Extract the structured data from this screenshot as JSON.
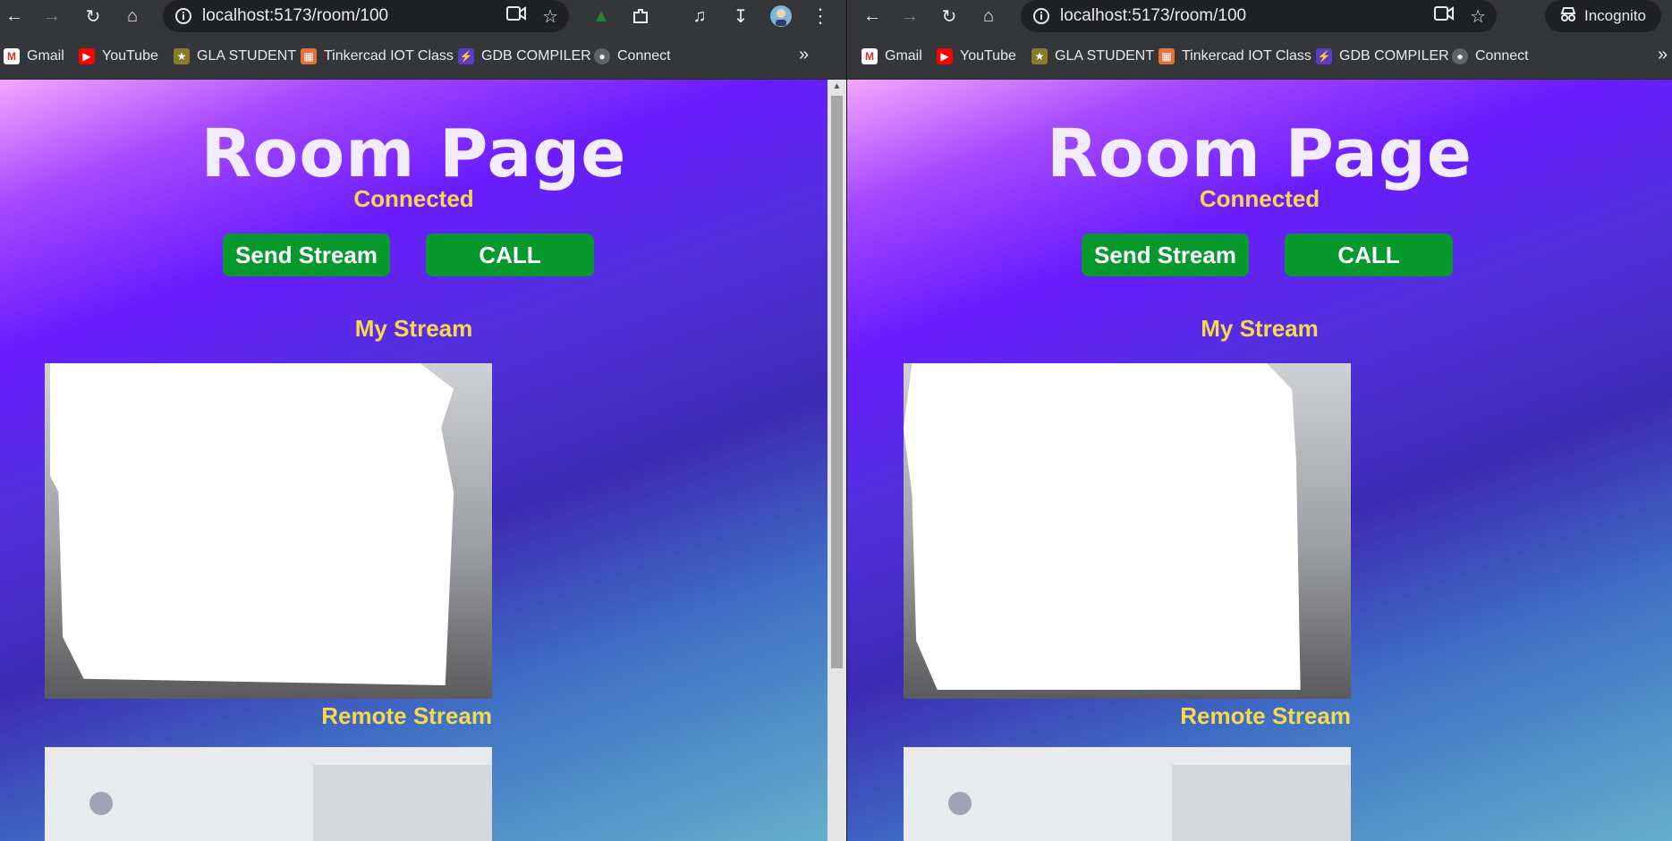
{
  "windows": [
    {
      "url": "localhost:5173/room/100",
      "bookmarks": [
        "Gmail",
        "YouTube",
        "GLA STUDENT",
        "Tinkercad IOT Class",
        "GDB COMPILER",
        "Connect"
      ],
      "page": {
        "title": "Room Page",
        "status": "Connected",
        "send_stream_label": "Send Stream",
        "call_label": "CALL",
        "my_stream_label": "My Stream",
        "remote_stream_label": "Remote Stream"
      }
    },
    {
      "url": "localhost:5173/room/100",
      "incognito_label": "Incognito",
      "bookmarks": [
        "Gmail",
        "YouTube",
        "GLA STUDENT",
        "Tinkercad IOT Class",
        "GDB COMPILER",
        "Connect"
      ],
      "page": {
        "title": "Room Page",
        "status": "Connected",
        "send_stream_label": "Send Stream",
        "call_label": "CALL",
        "my_stream_label": "My Stream",
        "remote_stream_label": "Remote Stream"
      }
    }
  ],
  "colors": {
    "accent_yellow": "#f7d94c",
    "button_green": "#07992e",
    "title_white": "#f1ecff"
  },
  "icons": [
    "back-icon",
    "forward-icon",
    "reload-icon",
    "home-icon",
    "site-info-icon",
    "camera-icon",
    "star-icon",
    "extension-icon",
    "puzzle-icon",
    "media-icon",
    "download-icon",
    "avatar",
    "menu-icon",
    "incognito-icon"
  ]
}
